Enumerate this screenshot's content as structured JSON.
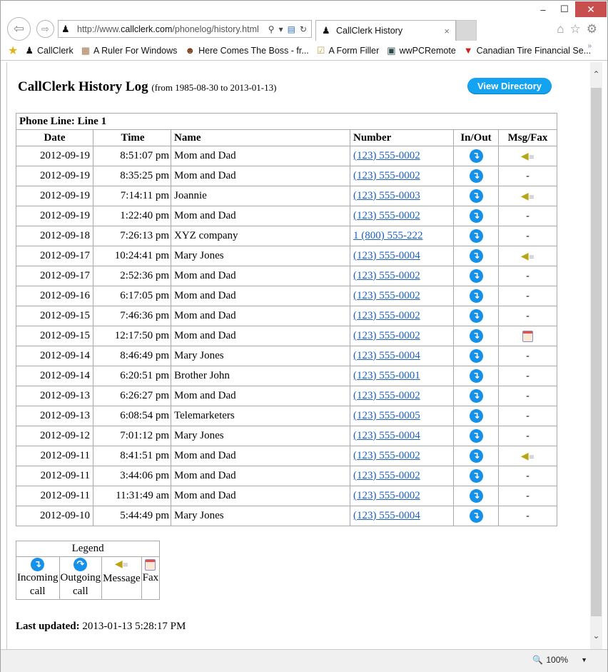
{
  "browser": {
    "window_controls": {
      "minimize": "–",
      "maximize": "☐",
      "close": "✕"
    },
    "address": {
      "url_prefix": "http://www.",
      "url_domain": "callclerk.com",
      "url_path": "/phonelog/history.html"
    },
    "tab": {
      "title": "CallClerk History",
      "close": "×"
    },
    "favorites": [
      {
        "label": "CallClerk",
        "icon": "callclerk-icon"
      },
      {
        "label": "A Ruler For Windows",
        "icon": "ruler-icon"
      },
      {
        "label": "Here Comes The Boss - fr...",
        "icon": "boss-icon"
      },
      {
        "label": "A Form Filler",
        "icon": "clipboard-icon"
      },
      {
        "label": "wwPCRemote",
        "icon": "remote-icon"
      },
      {
        "label": "Canadian Tire Financial Se...",
        "icon": "canadian-tire-icon"
      }
    ],
    "zoom_level": "100%"
  },
  "page": {
    "title": "CallClerk History Log",
    "date_range": "(from 1985-08-30 to 2013-01-13)",
    "view_directory_label": "View Directory",
    "line_header": "Phone Line: Line 1",
    "columns": {
      "date": "Date",
      "time": "Time",
      "name": "Name",
      "number": "Number",
      "inout": "In/Out",
      "msgfax": "Msg/Fax"
    },
    "rows": [
      {
        "date": "2012-09-19",
        "time": "8:51:07 pm",
        "name": "Mom and Dad",
        "number": "(123) 555-0002",
        "direction": "incoming",
        "msgfax": "message"
      },
      {
        "date": "2012-09-19",
        "time": "8:35:25 pm",
        "name": "Mom and Dad",
        "number": "(123) 555-0002",
        "direction": "incoming",
        "msgfax": "-"
      },
      {
        "date": "2012-09-19",
        "time": "7:14:11 pm",
        "name": "Joannie",
        "number": "(123) 555-0003",
        "direction": "incoming",
        "msgfax": "message"
      },
      {
        "date": "2012-09-19",
        "time": "1:22:40 pm",
        "name": "Mom and Dad",
        "number": "(123) 555-0002",
        "direction": "incoming",
        "msgfax": "-"
      },
      {
        "date": "2012-09-18",
        "time": "7:26:13 pm",
        "name": "XYZ company",
        "number": "1 (800) 555-222",
        "direction": "incoming",
        "msgfax": "-"
      },
      {
        "date": "2012-09-17",
        "time": "10:24:41 pm",
        "name": "Mary Jones",
        "number": "(123) 555-0004",
        "direction": "incoming",
        "msgfax": "message"
      },
      {
        "date": "2012-09-17",
        "time": "2:52:36 pm",
        "name": "Mom and Dad",
        "number": "(123) 555-0002",
        "direction": "incoming",
        "msgfax": "-"
      },
      {
        "date": "2012-09-16",
        "time": "6:17:05 pm",
        "name": "Mom and Dad",
        "number": "(123) 555-0002",
        "direction": "incoming",
        "msgfax": "-"
      },
      {
        "date": "2012-09-15",
        "time": "7:46:36 pm",
        "name": "Mom and Dad",
        "number": "(123) 555-0002",
        "direction": "incoming",
        "msgfax": "-"
      },
      {
        "date": "2012-09-15",
        "time": "12:17:50 pm",
        "name": "Mom and Dad",
        "number": "(123) 555-0002",
        "direction": "incoming",
        "msgfax": "fax"
      },
      {
        "date": "2012-09-14",
        "time": "8:46:49 pm",
        "name": "Mary Jones",
        "number": "(123) 555-0004",
        "direction": "incoming",
        "msgfax": "-"
      },
      {
        "date": "2012-09-14",
        "time": "6:20:51 pm",
        "name": "Brother John",
        "number": "(123) 555-0001",
        "direction": "incoming",
        "msgfax": "-"
      },
      {
        "date": "2012-09-13",
        "time": "6:26:27 pm",
        "name": "Mom and Dad",
        "number": "(123) 555-0002",
        "direction": "incoming",
        "msgfax": "-"
      },
      {
        "date": "2012-09-13",
        "time": "6:08:54 pm",
        "name": "Telemarketers",
        "number": "(123) 555-0005",
        "direction": "incoming",
        "msgfax": "-"
      },
      {
        "date": "2012-09-12",
        "time": "7:01:12 pm",
        "name": "Mary Jones",
        "number": "(123) 555-0004",
        "direction": "incoming",
        "msgfax": "-"
      },
      {
        "date": "2012-09-11",
        "time": "8:41:51 pm",
        "name": "Mom and Dad",
        "number": "(123) 555-0002",
        "direction": "incoming",
        "msgfax": "message"
      },
      {
        "date": "2012-09-11",
        "time": "3:44:06 pm",
        "name": "Mom and Dad",
        "number": "(123) 555-0002",
        "direction": "incoming",
        "msgfax": "-"
      },
      {
        "date": "2012-09-11",
        "time": "11:31:49 am",
        "name": "Mom and Dad",
        "number": "(123) 555-0002",
        "direction": "incoming",
        "msgfax": "-"
      },
      {
        "date": "2012-09-10",
        "time": "5:44:49 pm",
        "name": "Mary Jones",
        "number": "(123) 555-0004",
        "direction": "incoming",
        "msgfax": "-"
      }
    ],
    "legend": {
      "title": "Legend",
      "items": [
        {
          "icon": "incoming",
          "line1": "Incoming",
          "line2": "call"
        },
        {
          "icon": "outgoing",
          "line1": "Outgoing",
          "line2": "call"
        },
        {
          "icon": "message",
          "line1": "Message",
          "line2": ""
        },
        {
          "icon": "fax",
          "line1": "Fax",
          "line2": ""
        }
      ]
    },
    "last_updated_label": "Last updated:",
    "last_updated_value": "2013-01-13 5:28:17 PM"
  },
  "colors": {
    "accent": "#13a3f0",
    "link": "#1a5fbf",
    "close_button": "#c7504f"
  }
}
